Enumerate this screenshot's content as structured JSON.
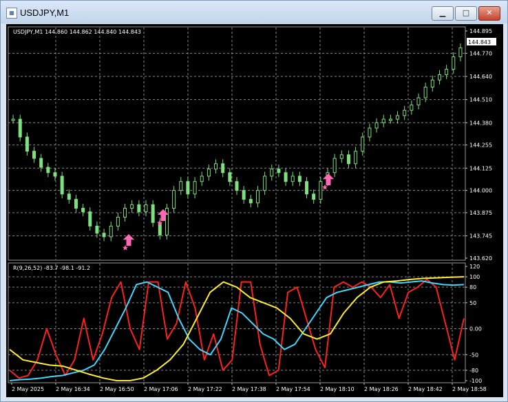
{
  "window": {
    "title": "USDJPY,M1",
    "icon": "chart-window-icon",
    "minimize_icon": "minimize-icon",
    "maximize_icon": "maximize-icon",
    "close_icon": "close-icon"
  },
  "price_chart": {
    "header": "USDJPY,M1  144.860 144.862 144.840 144.843",
    "current_price_label": "144.843",
    "y_ticks": [
      "144.895",
      "144.770",
      "144.640",
      "144.510",
      "144.380",
      "144.255",
      "144.125",
      "144.000",
      "143.875",
      "143.745",
      "143.620"
    ],
    "colors": {
      "background": "#000000",
      "candle": "#7ee07e",
      "grid": "#8a8a8a",
      "arrow": "#ff69b4"
    }
  },
  "indicator": {
    "header": "R(9,26,52) -83.7 -98.1 -91.2",
    "y_ticks": [
      "120",
      "100",
      "80",
      "50",
      "0.00",
      "-50",
      "-80",
      "-100"
    ],
    "colors": {
      "red": "#ff2020",
      "cyan": "#40d8ff",
      "yellow": "#ffee30"
    }
  },
  "x_ticks": [
    "2 May 2025",
    "2 May 16:34",
    "2 May 16:50",
    "2 May 17:06",
    "2 May 17:22",
    "2 May 17:38",
    "2 May 17:54",
    "2 May 18:10",
    "2 May 18:26",
    "2 May 18:42",
    "2 May 18:58"
  ],
  "chart_data": {
    "type": "line",
    "series": [
      {
        "name": "USDJPY,M1",
        "values": [
          144.4,
          144.3,
          144.22,
          144.18,
          144.13,
          144.1,
          144.08,
          143.98,
          143.95,
          143.9,
          143.88,
          143.8,
          143.76,
          143.74,
          143.8,
          143.85,
          143.9,
          143.92,
          143.88,
          143.92,
          143.82,
          143.75,
          143.9,
          144.0,
          144.05,
          143.98,
          144.05,
          144.08,
          144.12,
          144.15,
          144.1,
          144.05,
          144.0,
          143.95,
          143.93,
          144.0,
          144.08,
          144.12,
          144.1,
          144.05,
          144.08,
          144.05,
          143.98,
          143.95,
          144.05,
          144.1,
          144.18,
          144.2,
          144.15,
          144.22,
          144.3,
          144.35,
          144.38,
          144.4,
          144.4,
          144.42,
          144.45,
          144.48,
          144.52,
          144.58,
          144.62,
          144.65,
          144.68,
          144.75,
          144.8
        ]
      },
      {
        "name": "red",
        "values": [
          -80,
          -95,
          -90,
          -60,
          0,
          -50,
          -90,
          -60,
          20,
          -60,
          -10,
          60,
          90,
          0,
          -40,
          90,
          90,
          -20,
          10,
          90,
          40,
          -60,
          -10,
          -80,
          -60,
          90,
          90,
          -30,
          -90,
          -80,
          70,
          80,
          20,
          -40,
          -75,
          80,
          90,
          80,
          90,
          80,
          60,
          85,
          20,
          70,
          80,
          95,
          80,
          10,
          -60,
          20
        ]
      },
      {
        "name": "cyan",
        "values": [
          -100,
          -98,
          -97,
          -95,
          -92,
          -90,
          -85,
          -80,
          -70,
          -40,
          0,
          40,
          85,
          90,
          80,
          70,
          20,
          -20,
          -40,
          -50,
          -20,
          40,
          30,
          10,
          -10,
          -20,
          -40,
          -30,
          0,
          30,
          60,
          70,
          75,
          80,
          85,
          90,
          90,
          88,
          90,
          92,
          88,
          85,
          84,
          85
        ]
      },
      {
        "name": "yellow",
        "values": [
          -40,
          -60,
          -65,
          -70,
          -72,
          -80,
          -88,
          -95,
          -100,
          -100,
          -95,
          -80,
          -60,
          -30,
          20,
          70,
          90,
          80,
          60,
          50,
          40,
          20,
          -10,
          -20,
          -10,
          30,
          60,
          80,
          90,
          92,
          95,
          97,
          98,
          99,
          100
        ]
      }
    ],
    "ylim_price": [
      143.62,
      144.895
    ],
    "ylim_indicator": [
      -100,
      120
    ],
    "arrows_price": [
      143.76,
      143.9,
      144.1,
      143.87
    ],
    "grid": true
  }
}
